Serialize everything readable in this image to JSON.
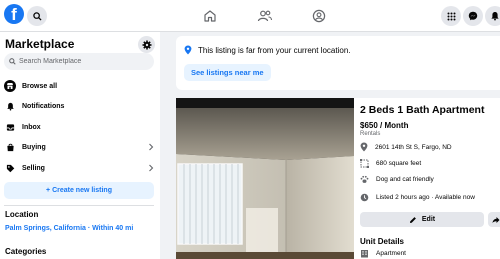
{
  "topbar": {
    "logo_letter": "f"
  },
  "sidebar": {
    "title": "Marketplace",
    "search_placeholder": "Search Marketplace",
    "items": [
      {
        "label": "Browse all",
        "icon": "storefront-icon"
      },
      {
        "label": "Notifications",
        "icon": "bell-icon"
      },
      {
        "label": "Inbox",
        "icon": "inbox-icon"
      },
      {
        "label": "Buying",
        "icon": "bag-icon"
      },
      {
        "label": "Selling",
        "icon": "tag-icon"
      }
    ],
    "create_label": "+ Create new listing",
    "location_heading": "Location",
    "location_value": "Palm Springs, California · Within 40 mi",
    "categories_heading": "Categories"
  },
  "notice": {
    "text": "This listing is far from your current location.",
    "button": "See listings near me"
  },
  "listing": {
    "title": "2 Beds 1 Bath Apartment",
    "price": "$650 / Month",
    "category": "Rentals",
    "address": "2601 14th St S, Fargo, ND",
    "size": "680 square feet",
    "pets": "Dog and cat friendly",
    "listed": "Listed 2 hours ago · Available now",
    "edit_label": "Edit",
    "unit_details_heading": "Unit Details",
    "unit_type": "Apartment"
  },
  "colors": {
    "brand_blue": "#1877f2",
    "light_blue_bg": "#e7f3ff",
    "page_bg": "#f0f2f5",
    "button_gray": "#e4e6eb"
  }
}
